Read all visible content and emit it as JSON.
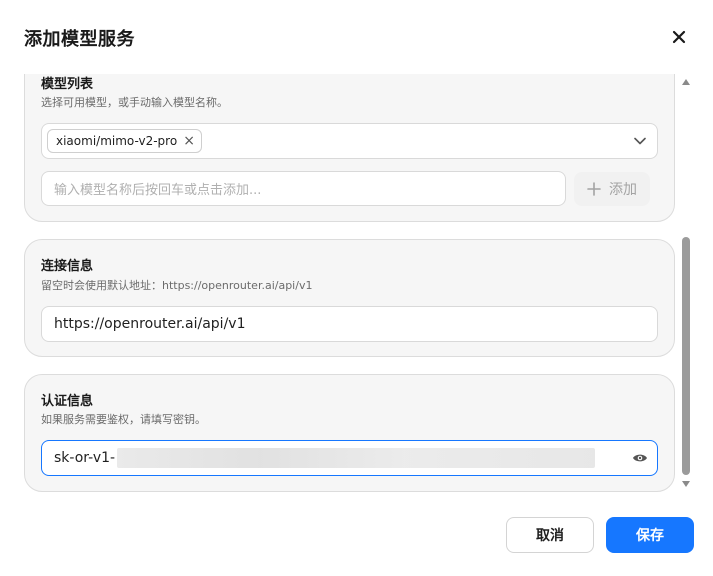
{
  "dialog": {
    "title": "添加模型服务",
    "close_icon": "close-icon"
  },
  "model_list": {
    "title": "模型列表",
    "description": "选择可用模型，或手动输入模型名称。",
    "selected_tags": [
      "xiaomi/mimo-v2-pro"
    ],
    "input_placeholder": "输入模型名称后按回车或点击添加...",
    "add_label": "添加",
    "add_icon": "plus-icon",
    "dropdown_icon": "chevron-down-icon"
  },
  "connection": {
    "title": "连接信息",
    "description": "留空时会使用默认地址：https://openrouter.ai/api/v1",
    "url_value": "https://openrouter.ai/api/v1"
  },
  "auth": {
    "title": "认证信息",
    "description": "如果服务需要鉴权，请填写密钥。",
    "key_prefix": "sk-or-v1-",
    "reveal_icon": "eye-icon"
  },
  "footer": {
    "cancel_label": "取消",
    "save_label": "保存"
  },
  "colors": {
    "primary": "#1677ff",
    "card_bg": "#f6f6f6",
    "focus_border": "#1677ff"
  }
}
